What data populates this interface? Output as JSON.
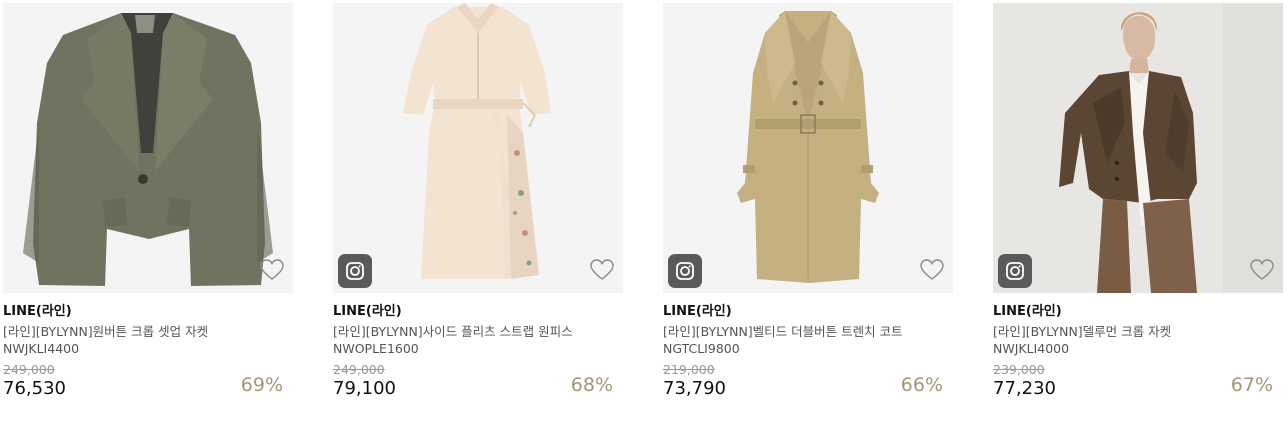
{
  "colors": {
    "discount": "#a59772",
    "original_price": "#999999",
    "thumb_bg": "#f4f4f4",
    "insta_badge": "#5a5a5a"
  },
  "icons": {
    "wishlist": "heart-outline-icon",
    "instagram": "instagram-icon"
  },
  "products": [
    {
      "brand": "LINE(라인)",
      "name": "[라인][BYLYNN]원버튼 크롭 셋업 자켓",
      "code": "NWJKLI4400",
      "original_price": "249,000",
      "price": "76,530",
      "discount": "69%",
      "instagram_badge": false
    },
    {
      "brand": "LINE(라인)",
      "name": "[라인][BYLYNN]사이드 플리츠 스트랩 원피스",
      "code": "NWOPLE1600",
      "original_price": "249,000",
      "price": "79,100",
      "discount": "68%",
      "instagram_badge": true
    },
    {
      "brand": "LINE(라인)",
      "name": "[라인][BYLYNN]벨티드 더블버튼 트렌치 코트",
      "code": "NGTCLI9800",
      "original_price": "219,000",
      "price": "73,790",
      "discount": "66%",
      "instagram_badge": true
    },
    {
      "brand": "LINE(라인)",
      "name": "[라인][BYLYNN]델루먼 크롭 자켓",
      "code": "NWJKLI4000",
      "original_price": "239,000",
      "price": "77,230",
      "discount": "67%",
      "instagram_badge": true
    }
  ]
}
